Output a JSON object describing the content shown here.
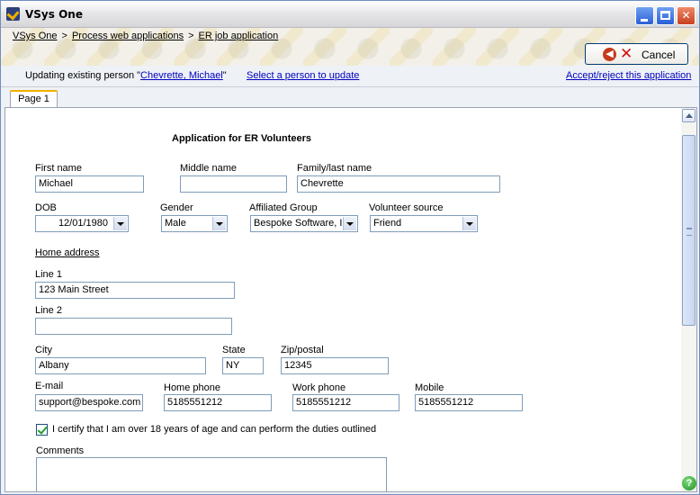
{
  "window": {
    "title": "VSys One",
    "controls": {
      "minimize": "minimize",
      "maximize": "maximize",
      "close": "✕"
    }
  },
  "breadcrumb": {
    "items": [
      "VSys One",
      "Process web applications",
      "ER job application"
    ],
    "separator": ">"
  },
  "toolbar": {
    "cancel_label": "Cancel"
  },
  "status": {
    "prefix": "Updating existing person \"",
    "person_link": "Chevrette, Michael",
    "suffix": "\"",
    "select_person": "Select a person to update",
    "accept_reject": "Accept/reject this application"
  },
  "tabs": [
    {
      "label": "Page 1",
      "active": true
    }
  ],
  "form": {
    "title": "Application for ER Volunteers",
    "first_name": {
      "label": "First name",
      "value": "Michael"
    },
    "middle_name": {
      "label": "Middle name",
      "value": ""
    },
    "family_name": {
      "label": "Family/last name",
      "value": "Chevrette"
    },
    "dob": {
      "label": "DOB",
      "value": "12/01/1980"
    },
    "gender": {
      "label": "Gender",
      "value": "Male"
    },
    "affiliated_group": {
      "label": "Affiliated Group",
      "value": "Bespoke Software, I"
    },
    "volunteer_source": {
      "label": "Volunteer source",
      "value": "Friend"
    },
    "home_address_heading": "Home address",
    "line1": {
      "label": "Line 1",
      "value": "123 Main Street"
    },
    "line2": {
      "label": "Line 2",
      "value": ""
    },
    "city": {
      "label": "City",
      "value": "Albany"
    },
    "state": {
      "label": "State",
      "value": "NY"
    },
    "zip": {
      "label": "Zip/postal",
      "value": "12345"
    },
    "email": {
      "label": "E-mail",
      "value": "support@bespoke.com"
    },
    "home_phone": {
      "label": "Home phone",
      "value": "5185551212"
    },
    "work_phone": {
      "label": "Work phone",
      "value": "5185551212"
    },
    "mobile": {
      "label": "Mobile",
      "value": "5185551212"
    },
    "certify": {
      "label": "I certify that I am over 18 years of age and can perform the duties outlined",
      "checked": true
    },
    "comments": {
      "label": "Comments",
      "value": ""
    }
  },
  "help_glyph": "?",
  "colors": {
    "accent": "#f0b000",
    "link": "#0000c0",
    "border": "#7f9db9"
  }
}
